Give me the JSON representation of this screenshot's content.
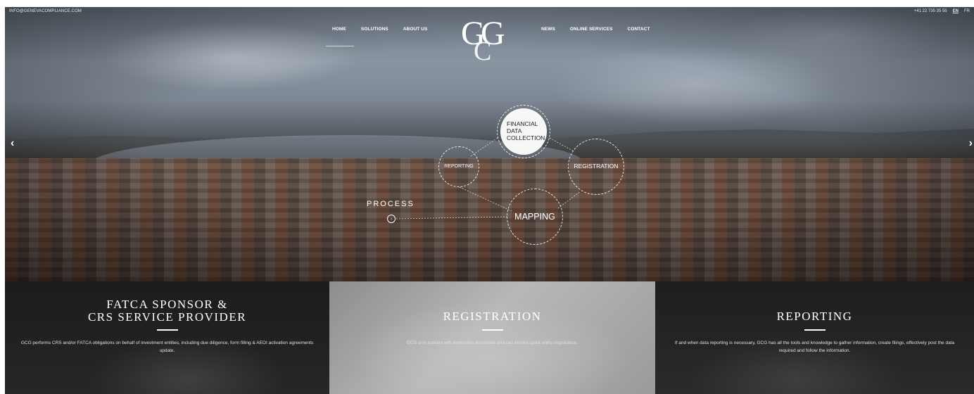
{
  "topbar": {
    "email": "INFO@GENEVACOMPLIANCE.COM",
    "phone": "+41 22 735 35 55",
    "lang_active": "EN",
    "lang_other": "FR"
  },
  "nav": {
    "left": [
      "HOME",
      "SOLUTIONS",
      "ABOUT US"
    ],
    "right": [
      "NEWS",
      "ONLINE SERVICES",
      "CONTACT"
    ]
  },
  "logo": {
    "letter1": "G",
    "letter2": "G",
    "letter3": "C"
  },
  "slider": {
    "prev": "‹",
    "next": "›"
  },
  "process": {
    "label": "PROCESS",
    "button_icon": "chevron-right-circle-icon",
    "steps": {
      "financial": "FINANCIAL DATA COLLECTION",
      "reporting": "REPORTING",
      "registration": "REGISTRATION",
      "mapping": "MAPPING"
    }
  },
  "panels": [
    {
      "title_line1": "FATCA SPONSOR &",
      "title_line2": "CRS SERVICE PROVIDER",
      "text": "GCG performs CRS and/or FATCA obligations on behalf of investment entities, including due diligence, form filling & AEOI activation agreements update."
    },
    {
      "title": "REGISTRATION",
      "text": "GCG is in contact with authorities worldwide and can ensure quick entity registration."
    },
    {
      "title": "REPORTING",
      "text": "If and when data reporting is necessary, GCG has all the tools and knowledge to gather information, create filings, effectively post the data required and follow the information."
    }
  ]
}
